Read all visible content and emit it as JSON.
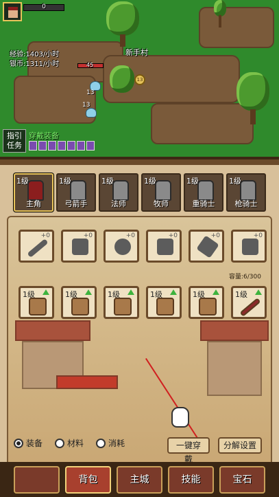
{
  "hud": {
    "hp_value": "0",
    "exp_rate": "经验:1403/小时",
    "silver_rate": "银币:1311/小时",
    "location": "新手村",
    "enemy_hp": "45",
    "mob_level_1": "13",
    "mob_level_2": "13",
    "coin_label": "13"
  },
  "quest": {
    "guide_label": "指引",
    "task_label": "任务",
    "title": "穿戴装备"
  },
  "characters": [
    {
      "level": "1级",
      "name": "主角"
    },
    {
      "level": "1级",
      "name": "弓箭手"
    },
    {
      "level": "1级",
      "name": "法师"
    },
    {
      "level": "1级",
      "name": "牧师"
    },
    {
      "level": "1级",
      "name": "重骑士"
    },
    {
      "level": "1级",
      "name": "枪骑士"
    }
  ],
  "equipment": [
    {
      "slot": "sword-icon",
      "plus": "+0"
    },
    {
      "slot": "helmet-icon",
      "plus": "+0"
    },
    {
      "slot": "armor-icon",
      "plus": "+0"
    },
    {
      "slot": "pants-icon",
      "plus": "+0"
    },
    {
      "slot": "bracer-icon",
      "plus": "+0"
    },
    {
      "slot": "boots-icon",
      "plus": "+0"
    }
  ],
  "capacity": "容量:6/300",
  "items": [
    {
      "level": "1级",
      "icon": "boots-icon"
    },
    {
      "level": "1级",
      "icon": "helmet-icon"
    },
    {
      "level": "1级",
      "icon": "armor-icon"
    },
    {
      "level": "1级",
      "icon": "pants-icon"
    },
    {
      "level": "1级",
      "icon": "bracer-icon"
    },
    {
      "level": "1级",
      "icon": "sword-icon"
    }
  ],
  "filters": [
    {
      "label": "装备",
      "selected": true
    },
    {
      "label": "材料",
      "selected": false
    },
    {
      "label": "消耗",
      "selected": false
    }
  ],
  "buttons": {
    "equip_all": "一键穿戴",
    "decompose_settings": "分解设置"
  },
  "tabs": [
    {
      "label": "",
      "active": false
    },
    {
      "label": "背包",
      "active": true
    },
    {
      "label": "主城",
      "active": false
    },
    {
      "label": "技能",
      "active": false
    },
    {
      "label": "宝石",
      "active": false
    }
  ],
  "colors": {
    "grass": "#2f8a2c",
    "panel": "#d8c09a",
    "tab": "#7a3a2a",
    "gold": "#e8c35a"
  }
}
